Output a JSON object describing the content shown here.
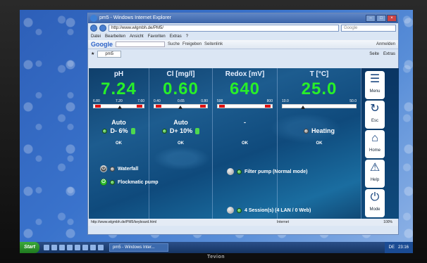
{
  "monitor": {
    "brand": "Tevion"
  },
  "browser": {
    "title": "pm5 - Windows Internet Explorer",
    "address": "http://www.wlgmbh.de/PM5/",
    "search_placeholder": "Google",
    "menu": [
      "Datei",
      "Bearbeiten",
      "Ansicht",
      "Favoriten",
      "Extras",
      "?"
    ],
    "gbar": {
      "logo": "Google",
      "items": [
        "Suche",
        "Freigeben",
        "Seitenlink",
        "Anmelden"
      ]
    },
    "tab": "pm5",
    "tab_tools": [
      "Seite",
      "Extras"
    ],
    "status_url": "http://www.wlgmbh.de/PM5/keyboard.html",
    "status_zone": "Internet",
    "zoom": "100%"
  },
  "app": {
    "params": [
      {
        "head": "pH",
        "value": "7.24",
        "min": "6.80",
        "set": "7.20",
        "max": "7.60",
        "mode": "Auto",
        "dose": "D- 6%",
        "status": "OK"
      },
      {
        "head": "Cl [mg/l]",
        "value": "0.60",
        "min": "0.40",
        "set": "0.65",
        "max": "0.80",
        "mode": "Auto",
        "dose": "D+ 10%",
        "status": "OK"
      },
      {
        "head": "Redox [mV]",
        "value": "640",
        "min": "500",
        "set": "",
        "max": "800",
        "mode": "-",
        "dose": "",
        "status": "OK"
      },
      {
        "head": "T [°C]",
        "value": "25.0",
        "min": "10.0",
        "set": "",
        "max": "50.0",
        "mode": "",
        "dose": "Heating",
        "status": "OK"
      }
    ],
    "outputs": {
      "waterfall": "Waterfall",
      "flockmatic": "Flockmatic pump",
      "filter": "Filter pump (Normal mode)",
      "sessions": "4 Session(s) (4 LAN / 0 Web)"
    },
    "side_buttons": [
      {
        "label": "Menu",
        "icon": "☰"
      },
      {
        "label": "Esc",
        "icon": "↻"
      },
      {
        "label": "Home",
        "icon": "⌂"
      },
      {
        "label": "Help",
        "icon": "⚠"
      },
      {
        "label": "Mode",
        "icon": "⏻"
      }
    ]
  },
  "taskbar": {
    "start": "Start",
    "task": "pm5 - Windows Inter...",
    "lang": "DE",
    "clock": "23:16"
  }
}
